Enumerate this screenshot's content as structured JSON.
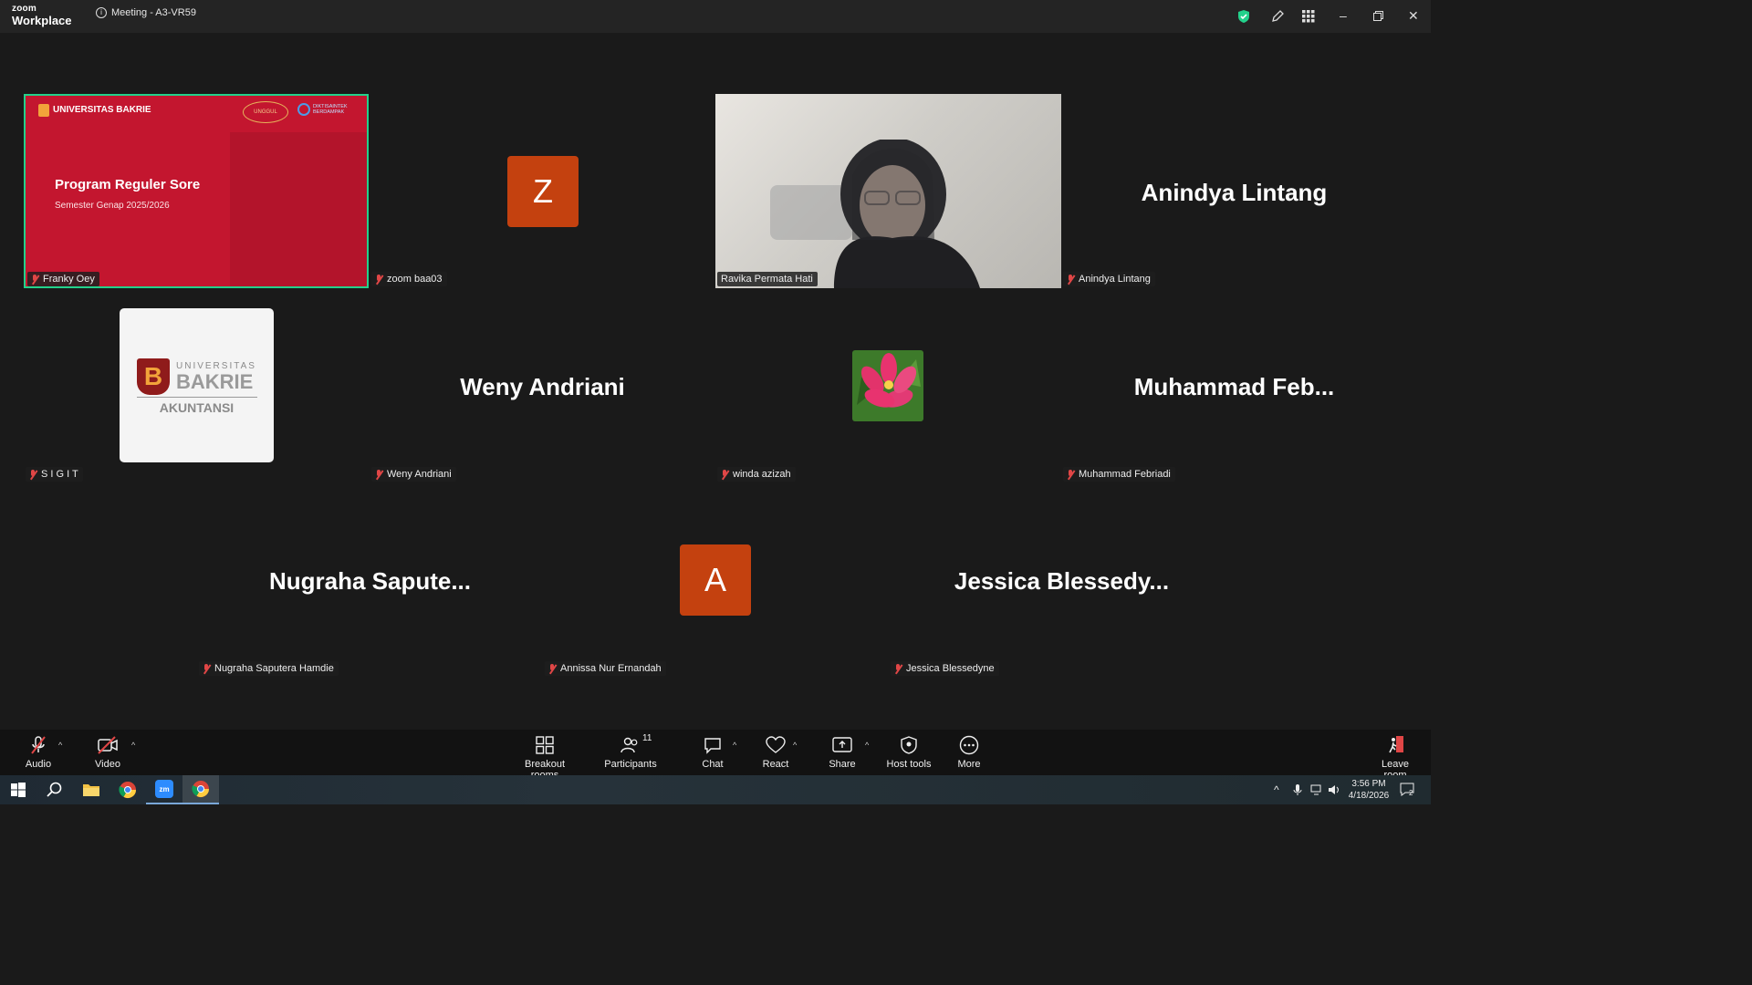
{
  "app": {
    "logo_top": "zoom",
    "logo_bottom": "Workplace",
    "meeting_title": "Meeting - A3-VR59"
  },
  "slide": {
    "brand": "UNIVERSITAS BAKRIE",
    "badge1": "UNGGUL",
    "badge2": "DIKTISAINTEK BERDAMPAK",
    "title": "Program Reguler Sore",
    "subtitle": "Semester Genap 2025/2026"
  },
  "logo_tile": {
    "line1": "UNIVERSITAS",
    "line2": "BAKRIE",
    "line3": "AKUNTANSI"
  },
  "participants": [
    {
      "tag": "Franky Oey"
    },
    {
      "tag": "zoom baa03",
      "letter": "Z"
    },
    {
      "tag": "Ravika Permata Hati"
    },
    {
      "tag": "Anindya Lintang",
      "display": "Anindya Lintang"
    },
    {
      "tag": "S I G I T"
    },
    {
      "tag": "Weny Andriani",
      "display": "Weny Andriani"
    },
    {
      "tag": "winda azizah"
    },
    {
      "tag": "Muhammad Febriadi",
      "display": "Muhammad  Feb..."
    },
    {
      "tag": "Nugraha Saputera Hamdie",
      "display": "Nugraha  Sapute..."
    },
    {
      "tag": "Annissa Nur Ernandah",
      "letter": "A"
    },
    {
      "tag": "Jessica Blessedyne",
      "display": "Jessica  Blessedy..."
    }
  ],
  "toolbar": {
    "audio": "Audio",
    "video": "Video",
    "breakout": "Breakout rooms",
    "participants": "Participants",
    "participant_count": "11",
    "chat": "Chat",
    "react": "React",
    "share": "Share",
    "host_tools": "Host tools",
    "more": "More",
    "leave": "Leave room"
  },
  "taskbar": {
    "time": "3:56 PM",
    "date": "4/18/2026",
    "notif_count": "2"
  },
  "colors": {
    "accent_green": "#23d18b",
    "avatar_orange": "#c4410f",
    "mute_red": "#e04646"
  }
}
